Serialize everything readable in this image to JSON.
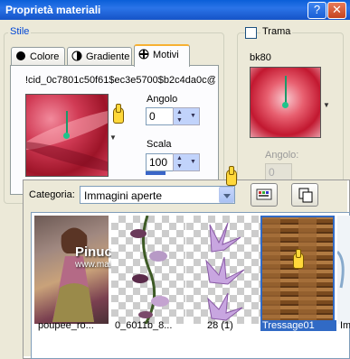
{
  "window": {
    "title": "Proprietà materiali",
    "help_glyph": "?",
    "close_glyph": "✕"
  },
  "style_group": {
    "label": "Stile"
  },
  "tabs": [
    {
      "label": "Colore",
      "icon": "filled-circle-icon"
    },
    {
      "label": "Gradiente",
      "icon": "half-circle-icon"
    },
    {
      "label": "Motivi",
      "icon": "pattern-icon",
      "active": true
    }
  ],
  "pattern": {
    "name": "!cid_0c7801c50f61$ec3e5700$b2c4da0c@",
    "angle_label": "Angolo",
    "angle_value": "0",
    "scale_label": "Scala",
    "scale_value": "100"
  },
  "texture": {
    "checkbox_label": "Trama",
    "checked": false,
    "name": "bk80",
    "angle_label": "Angolo:",
    "angle_value": "0"
  },
  "picker": {
    "category_label": "Categoria:",
    "category_value": "Immagini aperte",
    "items": [
      {
        "caption": "poupee_ro...",
        "selected": false
      },
      {
        "caption": "0_6011b_8...",
        "selected": false
      },
      {
        "caption": "28 (1)",
        "selected": false
      },
      {
        "caption": "Tressage01",
        "selected": true
      },
      {
        "caption": "Im",
        "selected": false
      }
    ],
    "watermark_title": "Pinuccia",
    "watermark_url": "www.maidiregrafica.eu"
  }
}
